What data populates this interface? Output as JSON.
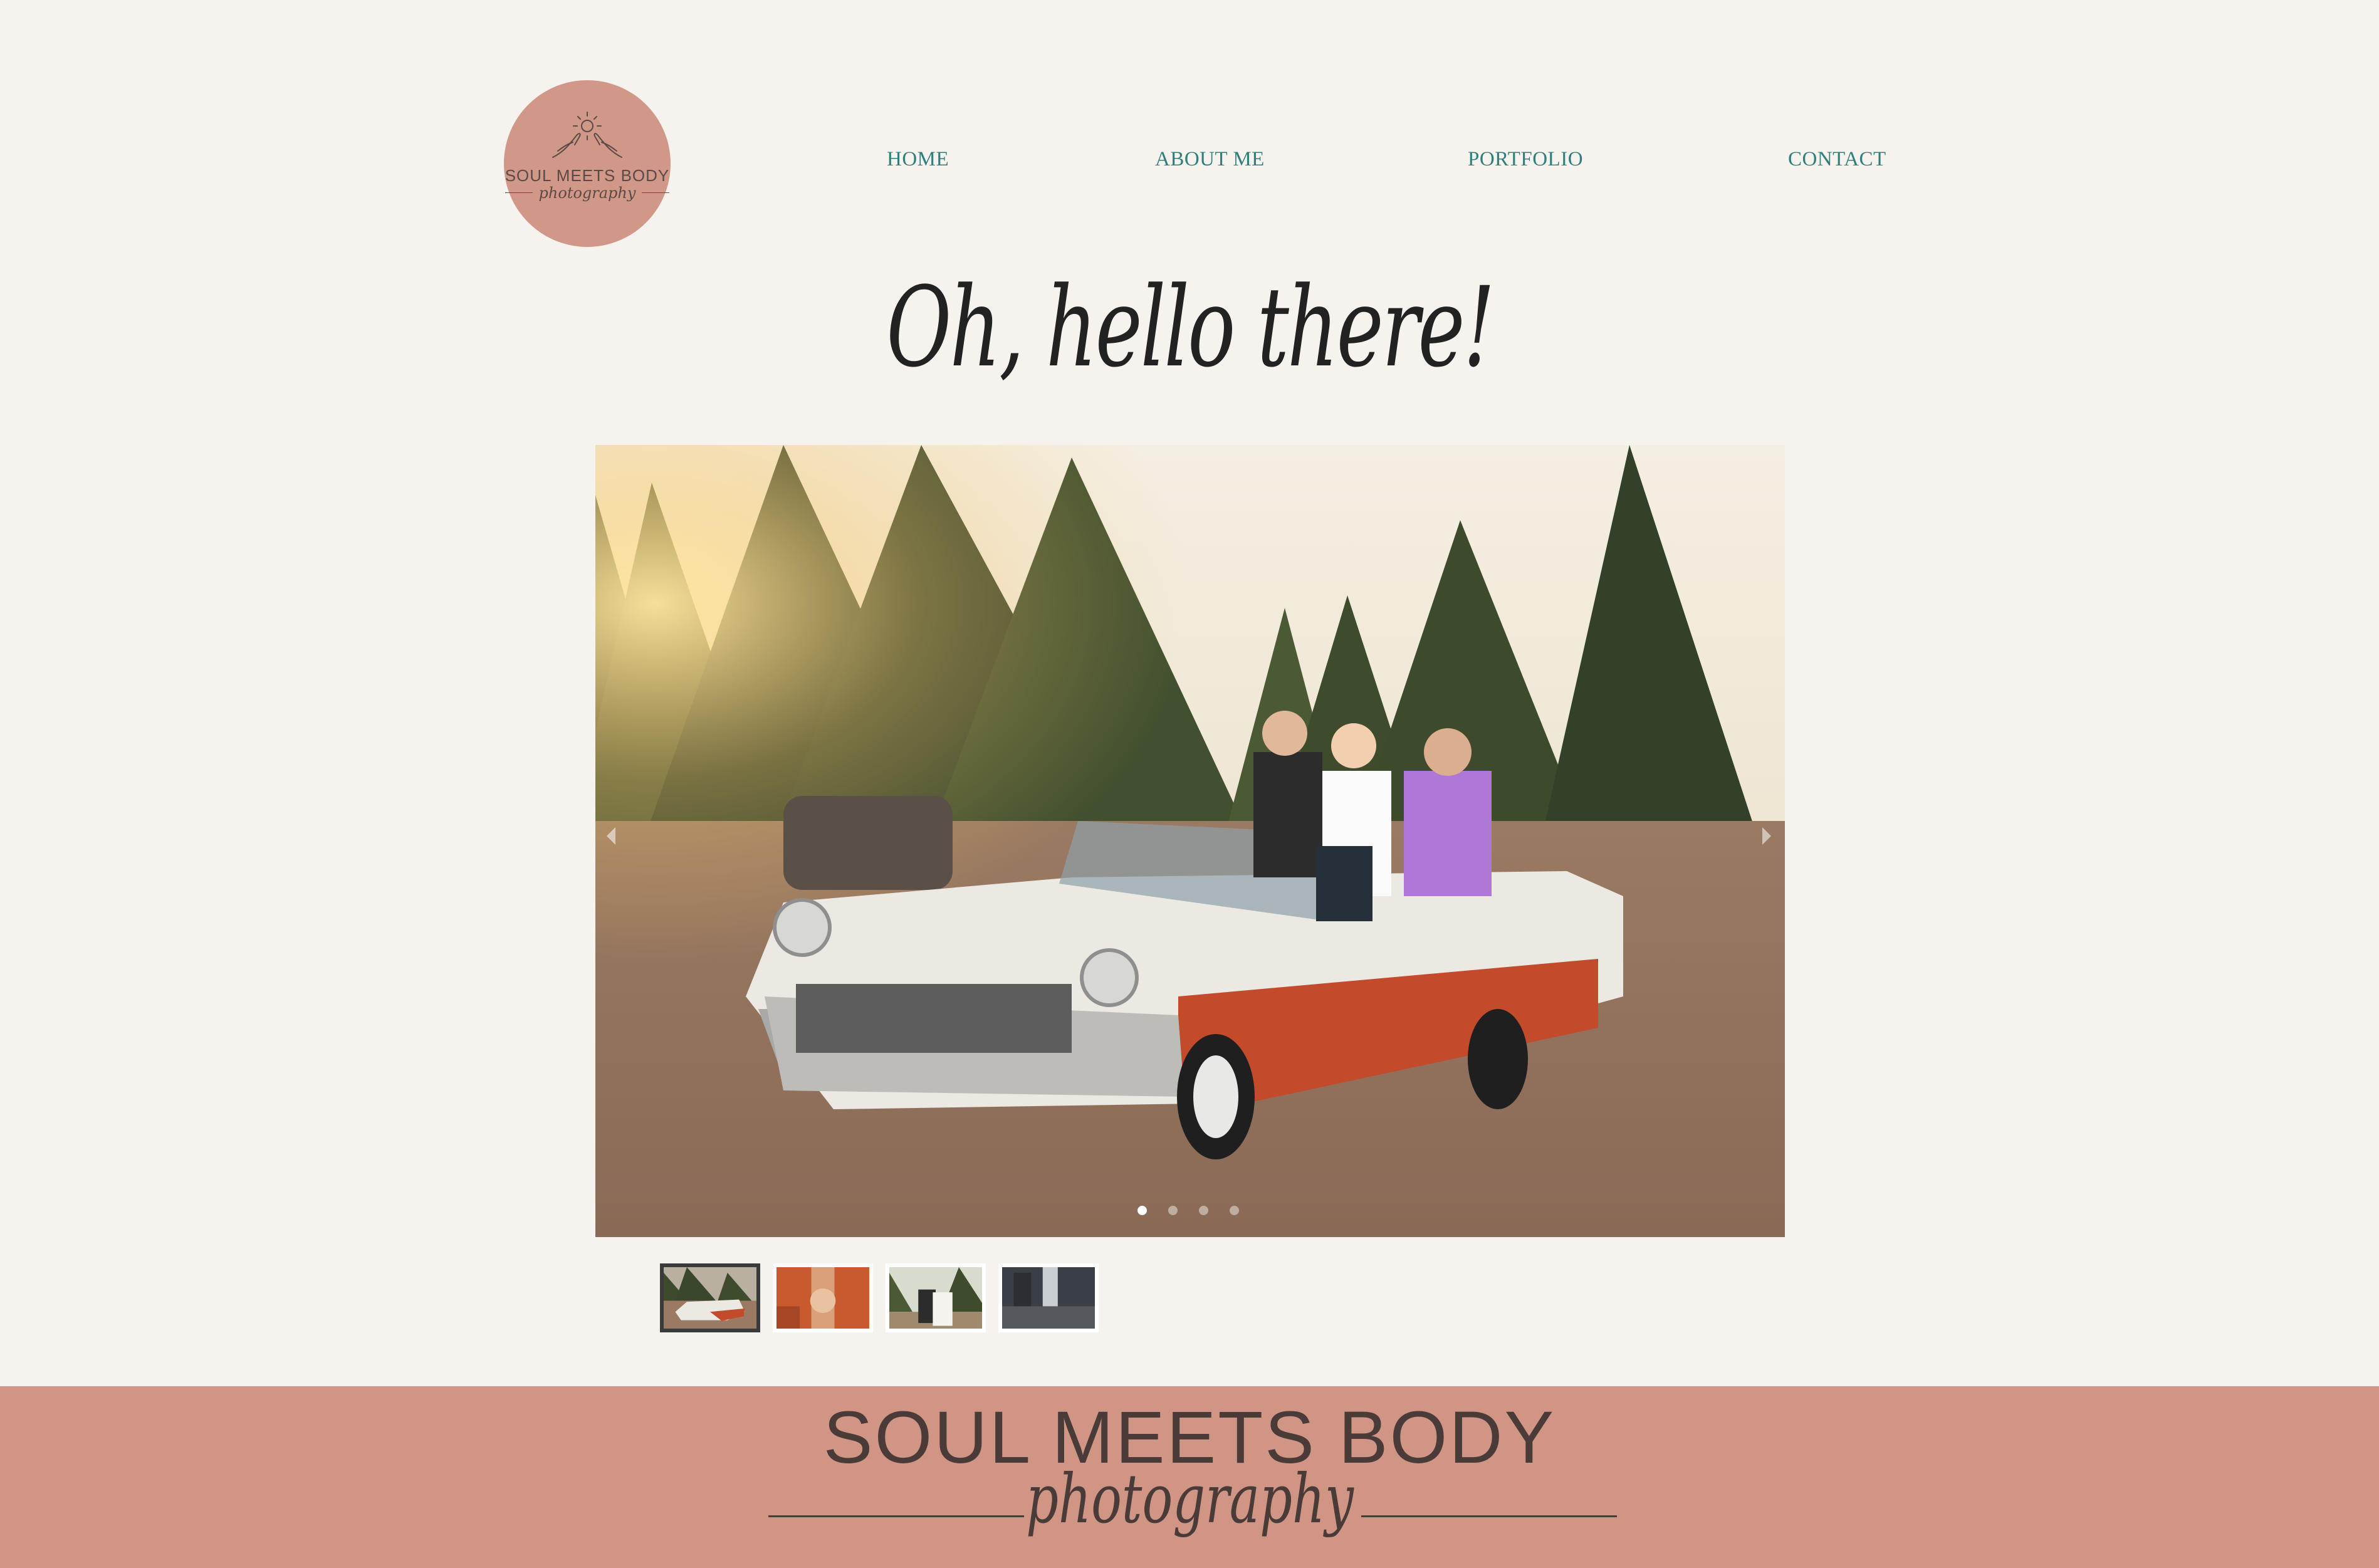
{
  "logo": {
    "name": "SOUL MEETS BODY",
    "sub": "photography"
  },
  "nav": {
    "home": "HOME",
    "about": "ABOUT ME",
    "portfolio": "PORTFOLIO",
    "contact": "CONTACT"
  },
  "hero": {
    "title": "Oh, hello there!"
  },
  "slideshow": {
    "slide_count": 4,
    "active_index": 1,
    "thumbnail_count": 4
  },
  "footer": {
    "name": "SOUL MEETS BODY",
    "sub": "photography"
  },
  "colors": {
    "background": "#f6f3ef",
    "accent_pink": "#d09584",
    "nav_teal": "#2f7f7c",
    "text_dark": "#4a3b38"
  },
  "icons": [
    "hands-sun-icon",
    "arrow-left-icon",
    "arrow-right-icon"
  ]
}
